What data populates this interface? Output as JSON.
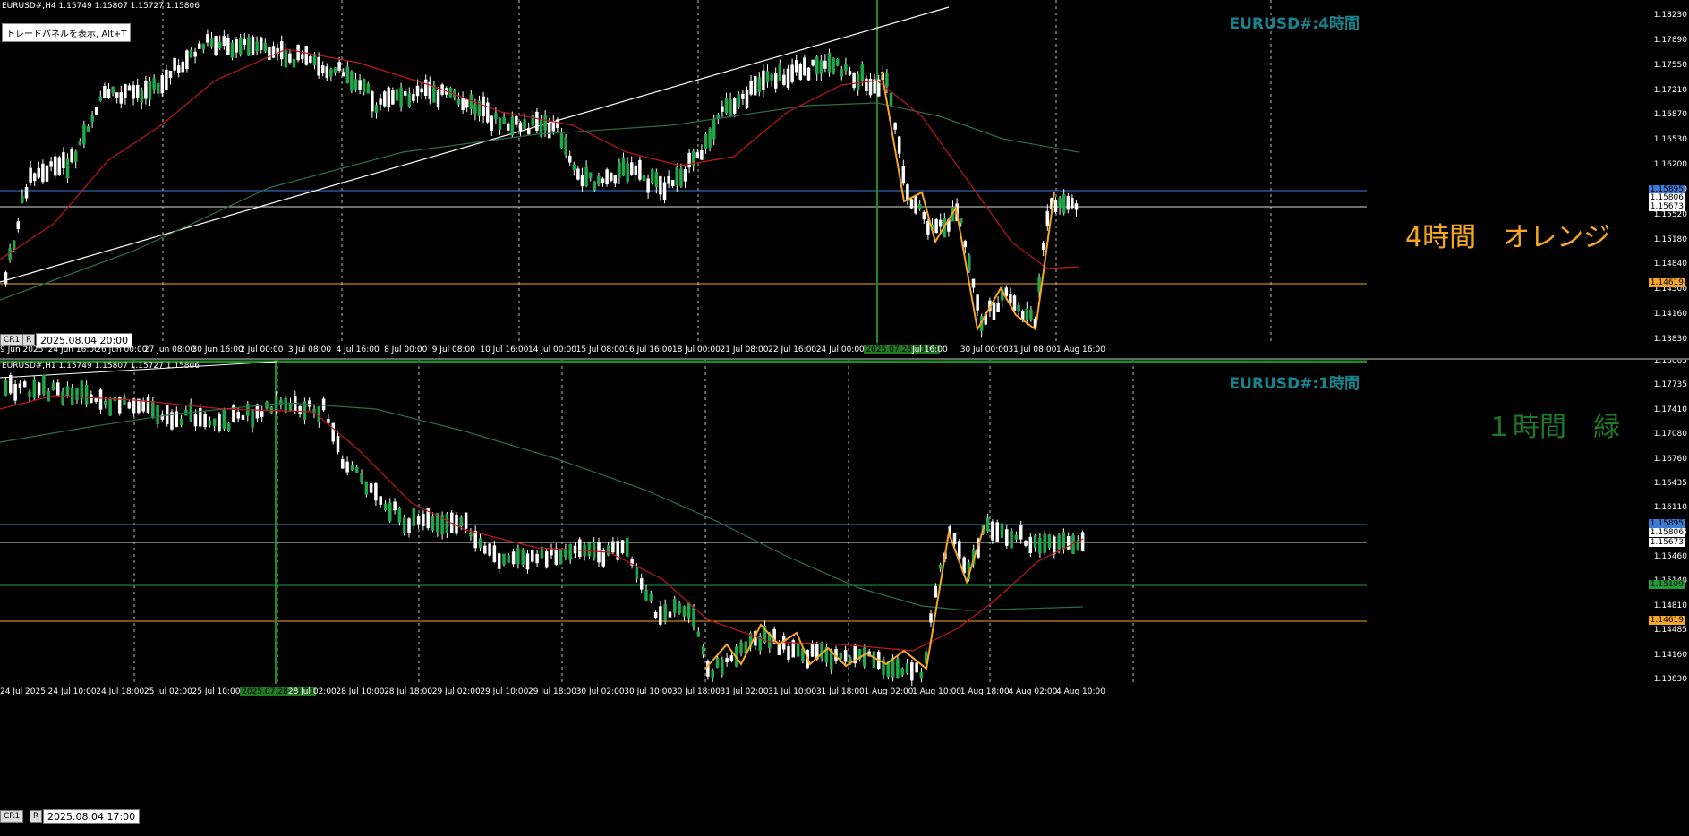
{
  "top": {
    "header": "EURUSD#,H4  1.15749 1.15807 1.15727 1.15806",
    "trade_button": "トレードパネルを表示, Alt+T",
    "title": "EURUSD#:4時間",
    "annotation": "4時間　オレンジ",
    "timestamp": "2025.08.04 20:00",
    "cr": "CR1",
    "r": "R",
    "y_ticks": [
      "1.18230",
      "1.17890",
      "1.17550",
      "1.17210",
      "1.16870",
      "1.16530",
      "1.16200",
      "1.15880",
      "1.15520",
      "1.15180",
      "1.14840",
      "1.14500",
      "1.14160",
      "1.13830"
    ],
    "price_labels": [
      {
        "text": "1.15895",
        "color": "#3b7bd8"
      },
      {
        "text": "1.15806",
        "color": "#ffffff"
      },
      {
        "text": "1.15673",
        "color": "#ffffff"
      },
      {
        "text": "1.14619",
        "color": "#f5a623"
      }
    ],
    "x_ticks": [
      "9 Jun 2025",
      "24 Jun 16:00",
      "26 Jun 00:00",
      "27 Jun 08:00",
      "30 Jun 16:00",
      "2 Jul 00:00",
      "3 Jul 08:00",
      "4 Jul 16:00",
      "8 Jul 00:00",
      "9 Jul 08:00",
      "10 Jul 16:00",
      "14 Jul 00:00",
      "15 Jul 08:00",
      "16 Jul 16:00",
      "18 Jul 00:00",
      "21 Jul 08:00",
      "22 Jul 16:00",
      "24 Jul 00:00",
      "2025.07.28 00:00",
      "Jul 16:00",
      "30 Jul 00:00",
      "31 Jul 08:00",
      "1 Aug 16:00"
    ]
  },
  "bottom": {
    "header": "EURUSD#,H1  1.15749 1.15807 1.15727 1.15806",
    "title": "EURUSD#:1時間",
    "annotation": "１時間　緑",
    "timestamp": "2025.08.04 17:00",
    "cr": "CR1",
    "r": "R",
    "y_ticks": [
      "1.18065",
      "1.17735",
      "1.17410",
      "1.17080",
      "1.16760",
      "1.16435",
      "1.16110",
      "1.15785",
      "1.15460",
      "1.15140",
      "1.14810",
      "1.14485",
      "1.14160",
      "1.13830"
    ],
    "price_labels": [
      {
        "text": "1.15895",
        "color": "#3b7bd8"
      },
      {
        "text": "1.15806",
        "color": "#ffffff"
      },
      {
        "text": "1.15673",
        "color": "#ffffff"
      },
      {
        "text": "1.15109",
        "color": "#1e9b3a"
      },
      {
        "text": "1.14619",
        "color": "#f5a623"
      }
    ],
    "x_ticks": [
      "24 Jul 2025",
      "24 Jul 10:00",
      "24 Jul 18:00",
      "25 Jul 02:00",
      "25 Jul 10:00",
      "2025.07.28 00:00",
      "28 Jul 02:00",
      "28 Jul 10:00",
      "28 Jul 18:00",
      "29 Jul 02:00",
      "29 Jul 10:00",
      "29 Jul 18:00",
      "30 Jul 02:00",
      "30 Jul 10:00",
      "30 Jul 18:00",
      "31 Jul 02:00",
      "31 Jul 10:00",
      "31 Jul 18:00",
      "1 Aug 02:00",
      "1 Aug 10:00",
      "1 Aug 18:00",
      "4 Aug 02:00",
      "4 Aug 10:00"
    ]
  },
  "colors": {
    "title": "#17838f",
    "annotation_top": "#f5a623",
    "annotation_bottom": "#1e7a2a",
    "zigzag": "#f5a623",
    "ma_fast": "#c0161b",
    "ma_slow": "#2e6b4a"
  }
}
